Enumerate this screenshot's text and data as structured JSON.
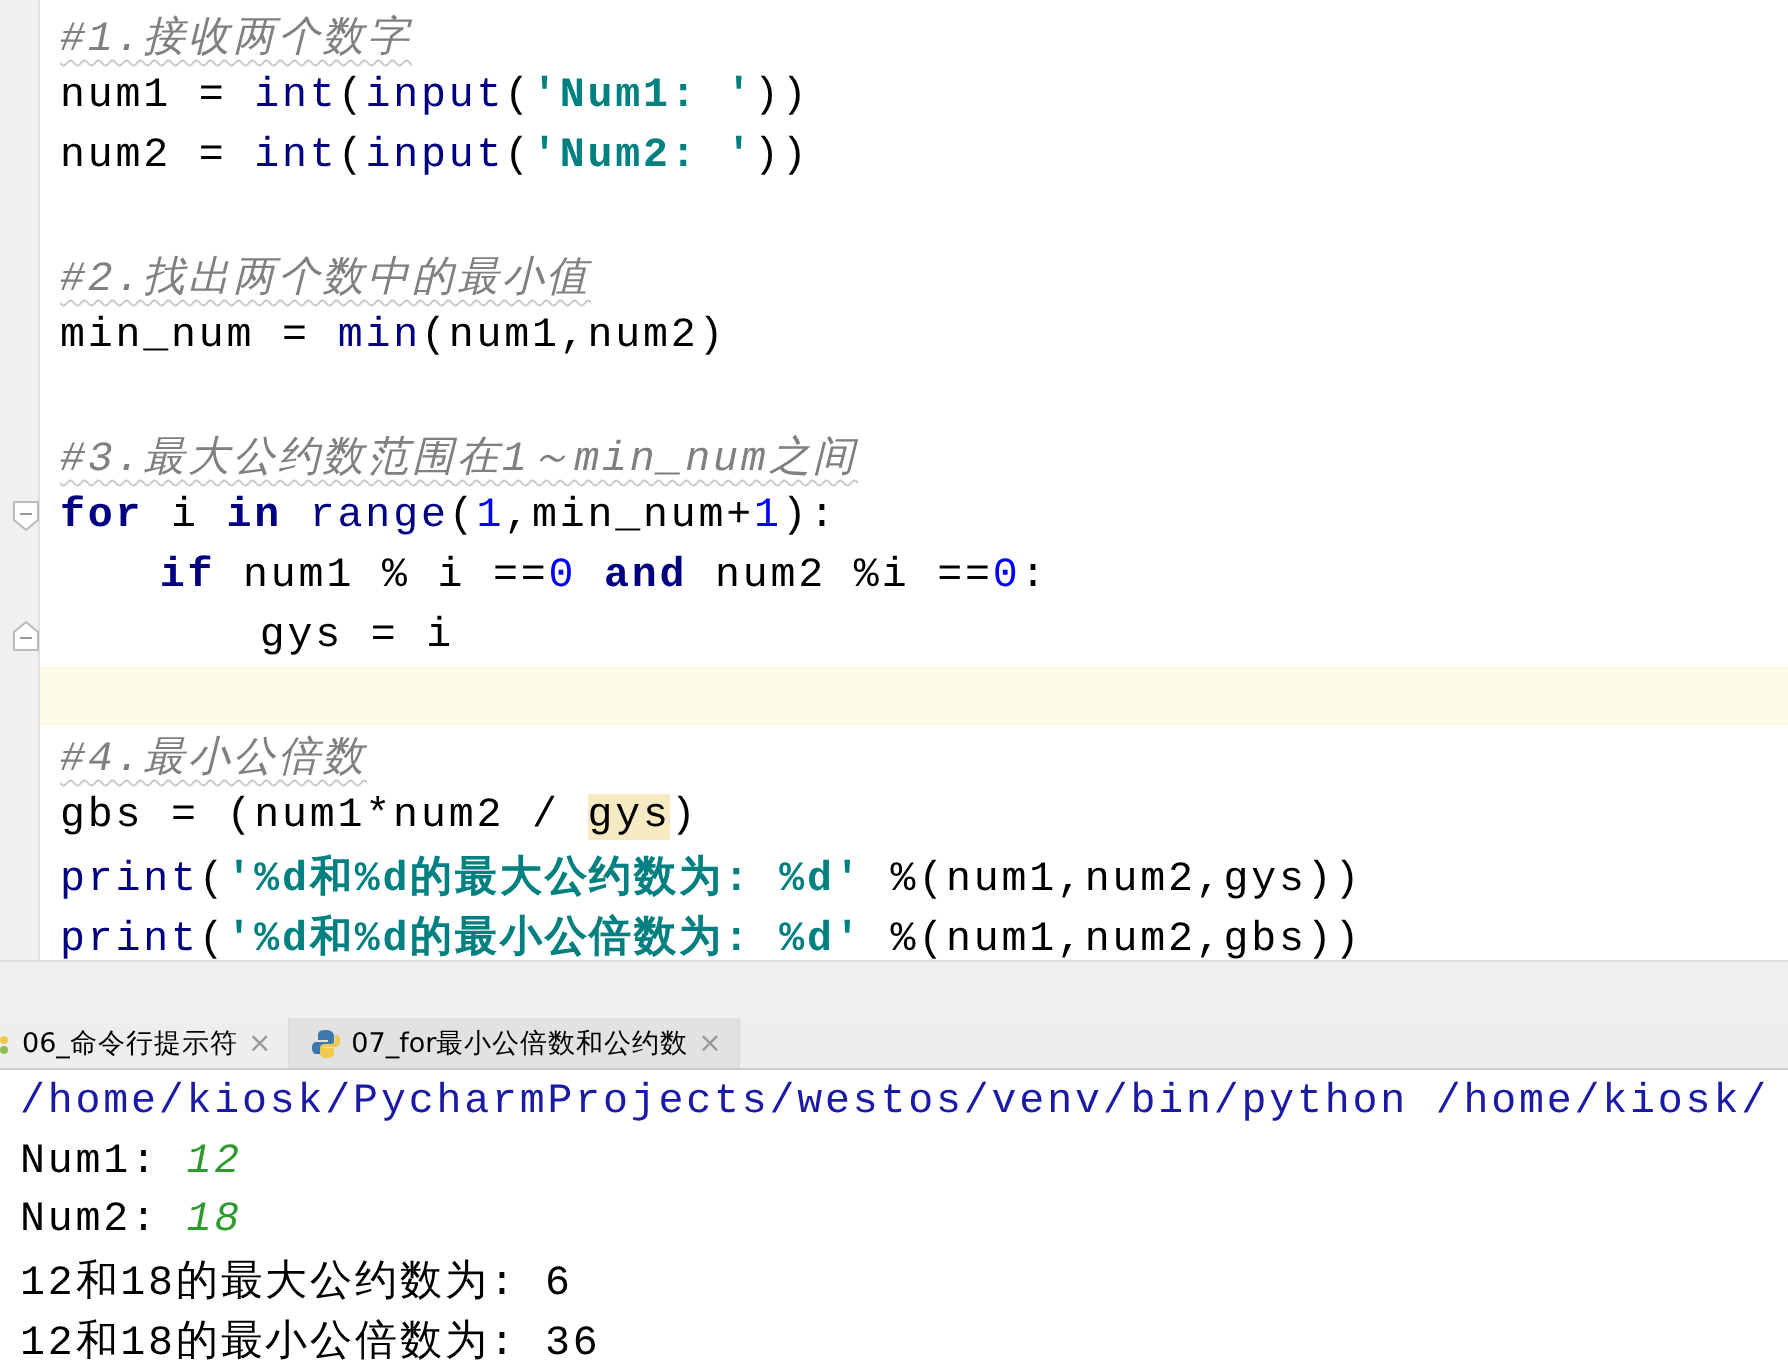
{
  "editor": {
    "lines": [
      {
        "current": false,
        "fold_start": false,
        "fold_end": false,
        "tokens": [
          {
            "kind": "comment",
            "text": "#1.接收两个数字"
          }
        ]
      },
      {
        "current": false,
        "fold_start": false,
        "fold_end": false,
        "tokens": [
          {
            "kind": "plain",
            "text": "num1 = "
          },
          {
            "kind": "builtin",
            "text": "int"
          },
          {
            "kind": "plain",
            "text": "("
          },
          {
            "kind": "builtin",
            "text": "input"
          },
          {
            "kind": "plain",
            "text": "("
          },
          {
            "kind": "string",
            "text": "'Num1: '"
          },
          {
            "kind": "plain",
            "text": "))"
          }
        ]
      },
      {
        "current": false,
        "fold_start": false,
        "fold_end": false,
        "tokens": [
          {
            "kind": "plain",
            "text": "num2 = "
          },
          {
            "kind": "builtin",
            "text": "int"
          },
          {
            "kind": "plain",
            "text": "("
          },
          {
            "kind": "builtin",
            "text": "input"
          },
          {
            "kind": "plain",
            "text": "("
          },
          {
            "kind": "string",
            "text": "'Num2: '"
          },
          {
            "kind": "plain",
            "text": "))"
          }
        ]
      },
      {
        "current": false,
        "fold_start": false,
        "fold_end": false
      },
      {
        "current": false,
        "fold_start": false,
        "fold_end": false,
        "tokens": [
          {
            "kind": "comment",
            "text": "#2.找出两个数中的最小值"
          }
        ]
      },
      {
        "current": false,
        "fold_start": false,
        "fold_end": false,
        "tokens": [
          {
            "kind": "plain",
            "text": "min_num = "
          },
          {
            "kind": "builtin",
            "text": "min"
          },
          {
            "kind": "plain",
            "text": "(num1,num2)"
          }
        ]
      },
      {
        "current": false,
        "fold_start": false,
        "fold_end": false
      },
      {
        "current": false,
        "fold_start": false,
        "fold_end": false,
        "tokens": [
          {
            "kind": "comment",
            "text": "#3.最大公约数范围在1～min_num之间"
          }
        ]
      },
      {
        "current": false,
        "fold_start": true,
        "fold_end": false,
        "tokens": [
          {
            "kind": "keyword",
            "text": "for"
          },
          {
            "kind": "plain",
            "text": " i "
          },
          {
            "kind": "keyword",
            "text": "in"
          },
          {
            "kind": "builtin",
            "text": " range"
          },
          {
            "kind": "plain",
            "text": "("
          },
          {
            "kind": "number",
            "text": "1"
          },
          {
            "kind": "plain",
            "text": ",min_num+"
          },
          {
            "kind": "number",
            "text": "1"
          },
          {
            "kind": "plain",
            "text": "):"
          }
        ],
        "children": [
          {
            "current": false,
            "fold_start": false,
            "fold_end": false,
            "tokens": [
              {
                "kind": "keyword",
                "text": "if"
              },
              {
                "kind": "plain",
                "text": " num1 % i =="
              },
              {
                "kind": "number",
                "text": "0"
              },
              {
                "kind": "keyword",
                "text": " and"
              },
              {
                "kind": "plain",
                "text": " num2 %i =="
              },
              {
                "kind": "number",
                "text": "0"
              },
              {
                "kind": "plain",
                "text": ":"
              }
            ],
            "children": [
              {
                "current": false,
                "fold_start": false,
                "fold_end": true,
                "tokens": [
                  {
                    "kind": "plain",
                    "text": "gys = i"
                  }
                ]
              }
            ]
          }
        ]
      },
      {
        "current": true,
        "fold_start": false,
        "fold_end": false
      },
      {
        "current": false,
        "fold_start": false,
        "fold_end": false,
        "tokens": [
          {
            "kind": "comment",
            "text": "#4.最小公倍数"
          }
        ]
      },
      {
        "current": false,
        "fold_start": false,
        "fold_end": false,
        "tokens": [
          {
            "kind": "plain",
            "text": "gbs = (num1*num2 / "
          },
          {
            "kind": "highlight",
            "text": "gys"
          },
          {
            "kind": "plain",
            "text": ")"
          }
        ]
      },
      {
        "current": false,
        "fold_start": false,
        "fold_end": false,
        "tokens": [
          {
            "kind": "builtin",
            "text": "print"
          },
          {
            "kind": "plain",
            "text": "("
          },
          {
            "kind": "string",
            "text": "'%d和%d的最大公约数为: %d'"
          },
          {
            "kind": "plain",
            "text": " %(num1,num2,gys))"
          }
        ]
      },
      {
        "current": false,
        "fold_start": false,
        "fold_end": false,
        "tokens": [
          {
            "kind": "builtin",
            "text": "print"
          },
          {
            "kind": "plain",
            "text": "("
          },
          {
            "kind": "string",
            "text": "'%d和%d的最小公倍数为: %d'"
          },
          {
            "kind": "plain",
            "text": " %(num1,num2,gbs))"
          }
        ]
      }
    ]
  },
  "run_tabs": [
    {
      "label": "06_命令行提示符",
      "close": "×",
      "selected": false
    },
    {
      "label": "07_for最小公倍数和公约数",
      "close": "×",
      "selected": true
    }
  ],
  "console": {
    "lines": [
      {
        "tokens": [
          {
            "kind": "path",
            "text": "/home/kiosk/PycharmProjects/westos/venv/bin/python /home/kiosk/"
          }
        ]
      },
      {
        "tokens": [
          {
            "kind": "output",
            "text": "Num1: "
          },
          {
            "kind": "input",
            "text": "12"
          }
        ]
      },
      {
        "tokens": [
          {
            "kind": "output",
            "text": "Num2: "
          },
          {
            "kind": "input",
            "text": "18"
          }
        ]
      },
      {
        "tokens": [
          {
            "kind": "output",
            "text": "12和18的最大公约数为: 6"
          }
        ]
      },
      {
        "tokens": [
          {
            "kind": "output",
            "text": "12和18的最小公倍数为: 36"
          }
        ]
      }
    ]
  }
}
